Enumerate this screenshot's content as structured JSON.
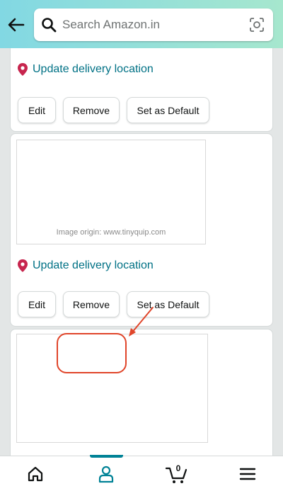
{
  "header": {
    "back_icon": "arrow-left-icon",
    "search_placeholder": "Search Amazon.in",
    "search_icon": "search-icon",
    "camera_icon": "camera-lens-icon"
  },
  "colors": {
    "header_gradient_start": "#82d8e3",
    "header_gradient_end": "#a6e7ce",
    "link": "#007185",
    "pin": "#c7254e",
    "annotation": "#e0452a",
    "nav_active": "#008296"
  },
  "cards": [
    {
      "location_link": "Update delivery location",
      "buttons": {
        "edit": "Edit",
        "remove": "Remove",
        "default": "Set as Default"
      }
    },
    {
      "image_watermark": "Image origin: www.tinyquip.com",
      "location_link": "Update delivery location",
      "buttons": {
        "edit": "Edit",
        "remove": "Remove",
        "default": "Set as Default"
      }
    },
    {}
  ],
  "bottom_nav": {
    "items": [
      {
        "name": "home",
        "icon": "home-icon"
      },
      {
        "name": "you",
        "icon": "person-icon",
        "active": true
      },
      {
        "name": "cart",
        "icon": "cart-icon",
        "count": "0"
      },
      {
        "name": "menu",
        "icon": "hamburger-menu-icon"
      }
    ]
  }
}
